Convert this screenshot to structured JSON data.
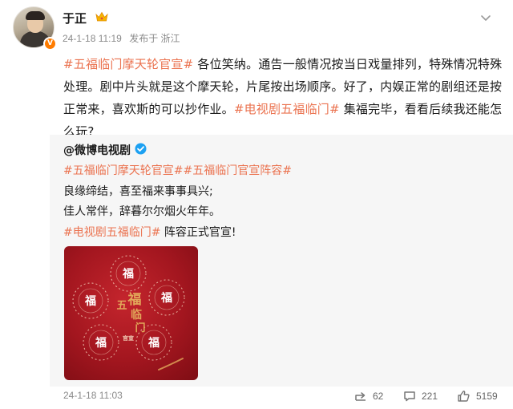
{
  "author": {
    "name": "于正",
    "time": "24-1-18 11:19",
    "source": "发布于 浙江"
  },
  "post": {
    "tag1": "#五福临门摩天轮官宣#",
    "text1": " 各位笑纳。通告一般情况按当日戏量排列，特殊情况特殊处理。剧中片头就是这个摩天轮，片尾按出场顺序。好了，内娱正常的剧组还是按正常来，喜欢斯的可以抄作业。",
    "tag2": "#电视剧五福临门#",
    "text2": " 集福完毕，看看后续我还能怎么玩?"
  },
  "repost": {
    "author": "@微博电视剧",
    "tag1": "#五福临门摩天轮官宣#",
    "tag2": "#五福临门官宣阵容#",
    "line2": "良缘缔结，喜至福来事事具兴;",
    "line3": "佳人常伴，辞暮尔尔烟火年年。",
    "tag3": "#电视剧五福临门#",
    "text3": " 阵容正式官宣!",
    "poster": {
      "fu_char": "福",
      "center_text": [
        "五",
        "福",
        "临",
        "门"
      ],
      "center_sub": "官宣"
    },
    "time": "24-1-18 11:03",
    "reposts": "62",
    "comments": "221",
    "likes": "5159"
  },
  "colors": {
    "tag": "#eb7350",
    "badge": "#ff7c00",
    "verified": "#1da1f2",
    "poster_red": "#b31b23",
    "gold": "#e2a85a"
  },
  "icons": [
    "chevron-down-icon",
    "vip-badge-icon",
    "crown-icon",
    "verified-icon",
    "share-icon",
    "comment-icon",
    "like-icon"
  ]
}
